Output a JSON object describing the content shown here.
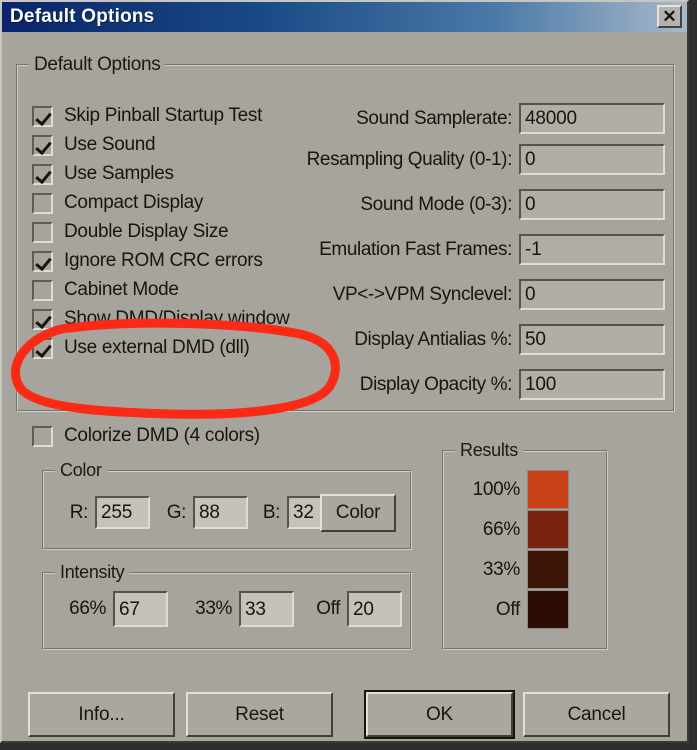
{
  "window": {
    "title": "Default Options",
    "close_icon": "close-icon",
    "close_label": "✕"
  },
  "main_group": {
    "legend": "Default Options",
    "checkboxes": [
      {
        "label": "Skip Pinball Startup Test",
        "checked": true
      },
      {
        "label": "Use Sound",
        "checked": true
      },
      {
        "label": "Use Samples",
        "checked": true
      },
      {
        "label": "Compact Display",
        "checked": false
      },
      {
        "label": "Double Display Size",
        "checked": false
      },
      {
        "label": "Ignore ROM CRC errors",
        "checked": true
      },
      {
        "label": "Cabinet Mode",
        "checked": false
      },
      {
        "label": "Show DMD/Display window",
        "checked": true
      },
      {
        "label": "Use external DMD (dll)",
        "checked": true
      }
    ],
    "fields": [
      {
        "label": "Sound Samplerate:",
        "value": "48000"
      },
      {
        "label": "Resampling Quality (0-1):",
        "value": "0"
      },
      {
        "label": "Sound Mode (0-3):",
        "value": "0"
      },
      {
        "label": "Emulation Fast Frames:",
        "value": "-1"
      },
      {
        "label": "VP<->VPM Synclevel:",
        "value": "0"
      },
      {
        "label": "Display Antialias %:",
        "value": "50"
      },
      {
        "label": "Display Opacity %:",
        "value": "100"
      }
    ]
  },
  "colorize": {
    "checkbox": {
      "label": "Colorize DMD (4 colors)",
      "checked": false
    },
    "color_group": {
      "legend": "Color",
      "r_label": "R:",
      "r_value": "255",
      "g_label": "G:",
      "g_value": "88",
      "b_label": "B:",
      "b_value": "32",
      "button_label": "Color"
    },
    "intensity_group": {
      "legend": "Intensity",
      "p66_label": "66%",
      "p66_value": "67",
      "p33_label": "33%",
      "p33_value": "33",
      "off_label": "Off",
      "off_value": "20"
    }
  },
  "results": {
    "legend": "Results",
    "swatches": [
      {
        "label": "100%",
        "color": "#c9421a"
      },
      {
        "label": "66%",
        "color": "#792411"
      },
      {
        "label": "33%",
        "color": "#3d1507"
      },
      {
        "label": "Off",
        "color": "#2b0d04"
      }
    ]
  },
  "buttons": {
    "info": "Info...",
    "reset": "Reset",
    "ok": "OK",
    "cancel": "Cancel"
  },
  "annotation": {
    "kind": "red-ellipse-highlight",
    "color": "#fb2a16",
    "targets": [
      "Show DMD/Display window",
      "Use external DMD (dll)"
    ]
  }
}
